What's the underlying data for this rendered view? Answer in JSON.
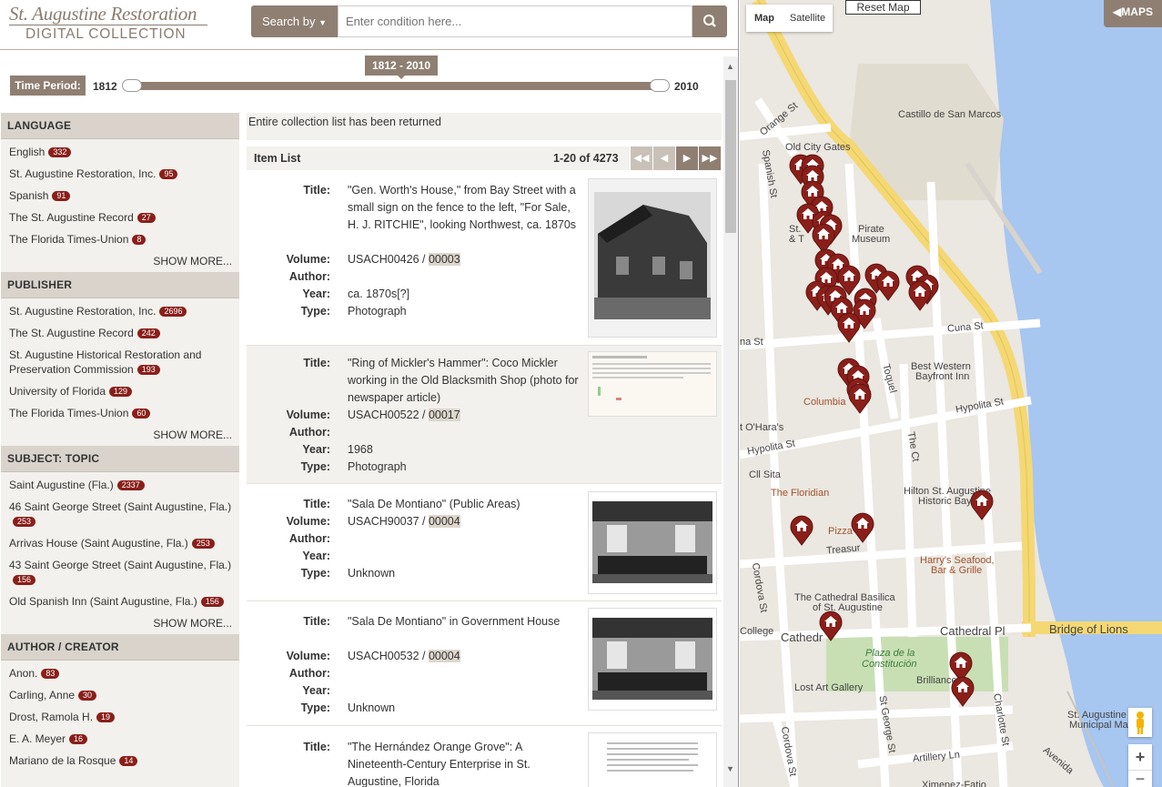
{
  "header": {
    "logo_line1": "St. Augustine Restoration",
    "logo_line2": "DIGITAL COLLECTION",
    "search_by": "Search by",
    "search_placeholder": "Enter condition here..."
  },
  "time_period": {
    "label": "Time Period:",
    "min": "1812",
    "max": "2010",
    "range_label": "1812 - 2010"
  },
  "facets": [
    {
      "title": "LANGUAGE",
      "items": [
        {
          "label": "English",
          "count": "332"
        },
        {
          "label": "St. Augustine Restoration, Inc.",
          "count": "95"
        },
        {
          "label": "Spanish",
          "count": "91"
        },
        {
          "label": "The St. Augustine Record",
          "count": "27"
        },
        {
          "label": "The Florida Times-Union",
          "count": "8"
        }
      ],
      "show_more": "SHOW MORE..."
    },
    {
      "title": "PUBLISHER",
      "items": [
        {
          "label": "St. Augustine Restoration, Inc.",
          "count": "2696"
        },
        {
          "label": "The St. Augustine Record",
          "count": "242"
        },
        {
          "label": "St. Augustine Historical Restoration and Preservation Commission",
          "count": "193"
        },
        {
          "label": "University of Florida",
          "count": "129"
        },
        {
          "label": "The Florida Times-Union",
          "count": "60"
        }
      ],
      "show_more": "SHOW MORE..."
    },
    {
      "title": "SUBJECT: TOPIC",
      "items": [
        {
          "label": "Saint Augustine (Fla.)",
          "count": "2337"
        },
        {
          "label": "46 Saint George Street (Saint Augustine, Fla.)",
          "count": "253"
        },
        {
          "label": "Arrivas House (Saint Augustine, Fla.)",
          "count": "253"
        },
        {
          "label": "43 Saint George Street (Saint Augustine, Fla.)",
          "count": "156"
        },
        {
          "label": "Old Spanish Inn (Saint Augustine, Fla.)",
          "count": "156"
        }
      ],
      "show_more": "SHOW MORE..."
    },
    {
      "title": "AUTHOR / CREATOR",
      "items": [
        {
          "label": "Anon.",
          "count": "83"
        },
        {
          "label": "Carling, Anne",
          "count": "30"
        },
        {
          "label": "Drost, Ramola H.",
          "count": "19"
        },
        {
          "label": "E. A. Meyer",
          "count": "16"
        },
        {
          "label": "Mariano de la Rosque",
          "count": "14"
        }
      ],
      "show_more": ""
    }
  ],
  "results": {
    "message": "Entire collection list has been returned",
    "list_title": "Item List",
    "range": "1-20 of 4273",
    "field_labels": {
      "title": "Title:",
      "volume": "Volume:",
      "author": "Author:",
      "year": "Year:",
      "type": "Type:"
    },
    "items": [
      {
        "title": "\"Gen. Worth's House,\" from Bay Street with a small sign on the fence to the left, \"For Sale, H. J. RITCHIE\", looking Northwest, ca. 1870s",
        "volume": "USACH00426",
        "volume_num": "00003",
        "author": "",
        "year": "ca. 1870s[?]",
        "type": "Photograph",
        "thumb": "house-photo"
      },
      {
        "title": "\"Ring of Mickler's Hammer\": Coco Mickler working in the Old Blacksmith Shop (photo for newspaper article)",
        "volume": "USACH00522",
        "volume_num": "00017",
        "author": "",
        "year": "1968",
        "type": "Photograph",
        "thumb": "newspaper-clipping"
      },
      {
        "title": "\"Sala De Montiano\" (Public Areas)",
        "volume": "USACH90037",
        "volume_num": "00004",
        "author": "",
        "year": "",
        "type": "Unknown",
        "thumb": "room-photo"
      },
      {
        "title": "\"Sala De Montiano\" in Government House",
        "volume": "USACH00532",
        "volume_num": "00004",
        "author": "",
        "year": "",
        "type": "Unknown",
        "thumb": "room-photo"
      },
      {
        "title": "\"The Hernández Orange Grove\": A Nineteenth-Century Enterprise in St. Augustine, Florida",
        "volume": "",
        "volume_num": "",
        "author": "",
        "year": "",
        "type": "",
        "thumb": "document-page"
      }
    ]
  },
  "map": {
    "map_button": "Map",
    "satellite_button": "Satellite",
    "reset_button": "Reset Map",
    "maps_tab": "MAPS",
    "labels": [
      "Castillo de San Marcos",
      "Old City Gates",
      "Orange St",
      "Spanish St",
      "Pirate",
      "Museum",
      "St.",
      "& T",
      "Cuna St",
      "na St",
      "Best Western",
      "Bayfront Inn",
      "Hypolita St",
      "Columbia",
      "t O'Hara's",
      "Hypolita St",
      "Cll Sita",
      "The Ct",
      "Toquel",
      "The Floridian",
      "Hilton St. Augustine",
      "Historic Bayfr",
      "Pizza T",
      "Treasur",
      "Harry's Seafood,",
      "Bar & Grille",
      "Cordova St",
      "The Cathedral Basilica",
      "of St. Augustine",
      "College",
      "Cathedr",
      "Cathedral Pl",
      "Bridge of Lions",
      "Plaza de la",
      "Constitución",
      "Brilliance",
      "Lost Art Gallery",
      "St George St",
      "Charlotte St",
      "St. Augustine",
      "Municipal Ma",
      "Artillery Ln",
      "Avenida",
      "Cordova St",
      "Ximenez-Fatio"
    ]
  }
}
